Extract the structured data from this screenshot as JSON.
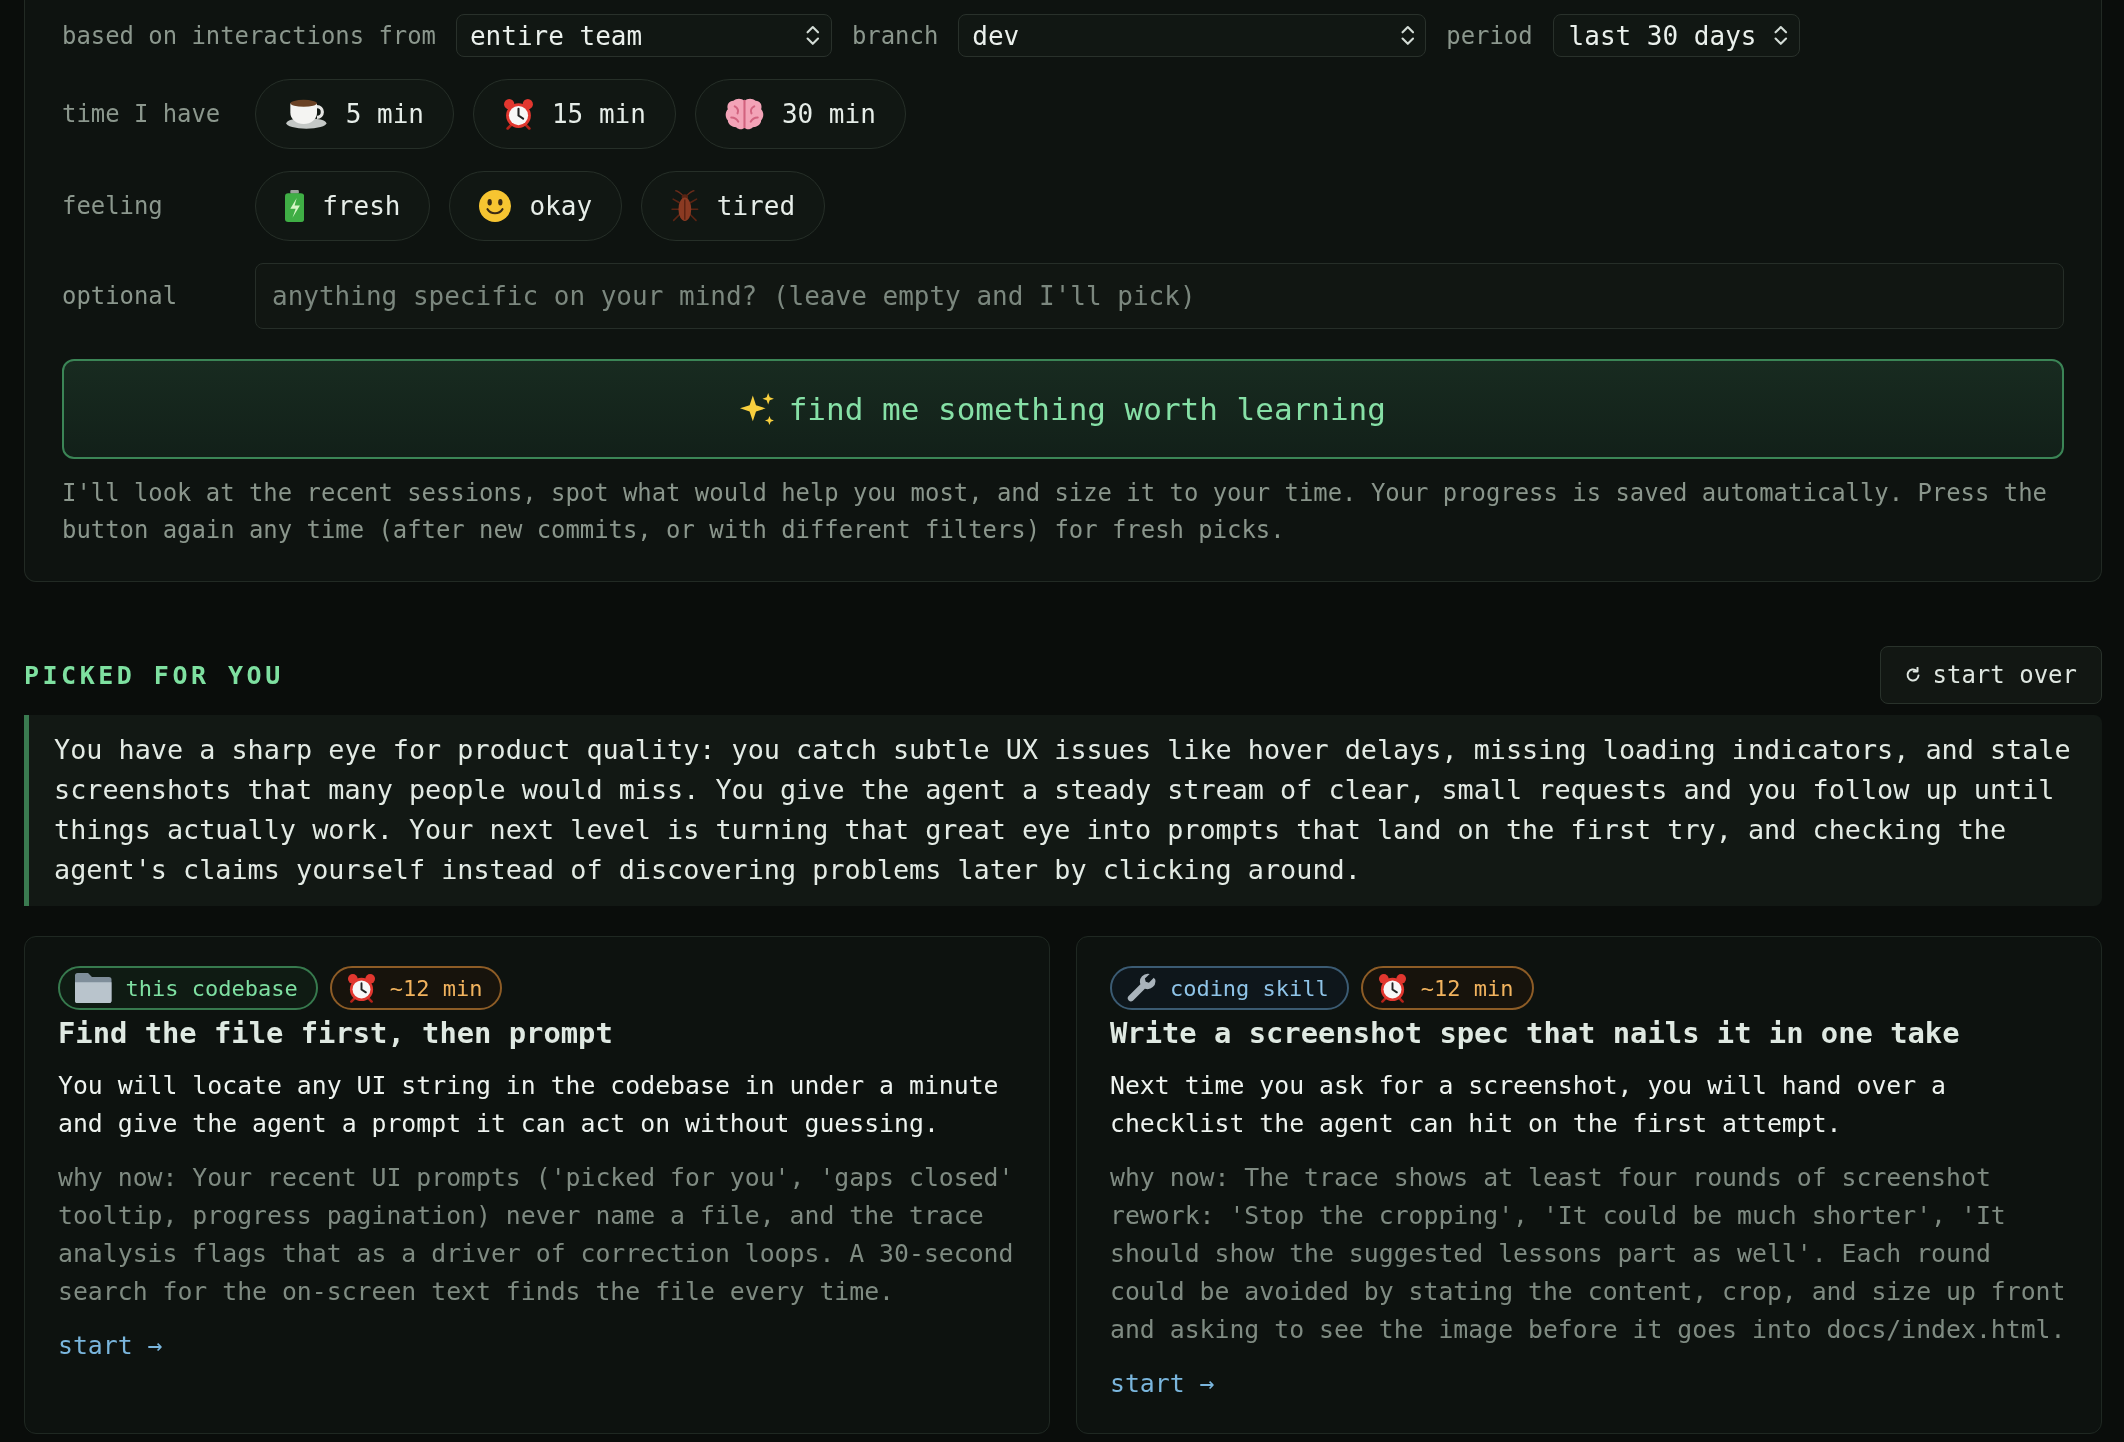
{
  "filters": [
    {
      "label": "based on interactions from",
      "value": "entire team"
    },
    {
      "label": "branch",
      "value": "dev"
    },
    {
      "label": "period",
      "value": "last 30 days"
    }
  ],
  "time": {
    "label": "time I have",
    "options": [
      {
        "label": "5 min",
        "selected": false
      },
      {
        "label": "15 min",
        "selected": false
      },
      {
        "label": "30 min",
        "selected": false
      }
    ]
  },
  "feeling": {
    "label": "feeling",
    "options": [
      {
        "label": "fresh",
        "selected": false
      },
      {
        "label": "okay",
        "selected": false
      },
      {
        "label": "tired",
        "selected": false
      }
    ]
  },
  "optional": {
    "label": "optional",
    "placeholder": "anything specific on your mind? (leave empty and I'll pick)"
  },
  "find_button": {
    "label": "find me something worth learning"
  },
  "hint": "I'll look at the recent sessions, spot what would help you most, and size it to your time. Your progress is saved automatically. Press the button again any time (after new commits, or with different filters) for fresh picks.",
  "picked": {
    "heading": "PICKED FOR YOU",
    "start_over_button": "start over",
    "summary": "You have a sharp eye for product quality: you catch subtle UX issues like hover delays, missing loading indicators, and stale screenshots that many people would miss. You give the agent a steady stream of clear, small requests and you follow up until things actually work. Your next level is turning that great eye into prompts that land on the first try, and checking the agent's claims yourself instead of discovering problems later by clicking around.",
    "cards": [
      {
        "tags": [
          {
            "kind": "codebase",
            "label": "this codebase"
          },
          {
            "kind": "time",
            "label": "~12 min"
          }
        ],
        "title": "Find the file first, then prompt",
        "goal": "You will locate any UI string in the codebase in under a minute and give the agent a prompt it can act on without guessing.",
        "why_now": "why now: Your recent UI prompts ('picked for you', 'gaps closed' tooltip, progress pagination) never name a file, and the trace analysis flags that as a driver of correction loops. A 30-second search for the on-screen text finds the file every time.",
        "start_link": "start →"
      },
      {
        "tags": [
          {
            "kind": "skill",
            "label": "coding skill"
          },
          {
            "kind": "time",
            "label": "~12 min"
          }
        ],
        "title": "Write a screenshot spec that nails it in one take",
        "goal": "Next time you ask for a screenshot, you will hand over a checklist the agent can hit on the first attempt.",
        "why_now": "why now: The trace shows at least four rounds of screenshot rework: 'Stop the cropping', 'It could be much shorter', 'It should show the suggested lessons part as well'. Each round could be avoided by stating the content, crop, and size up front and asking to see the image before it goes into docs/index.html.",
        "start_link": "start →"
      }
    ]
  }
}
